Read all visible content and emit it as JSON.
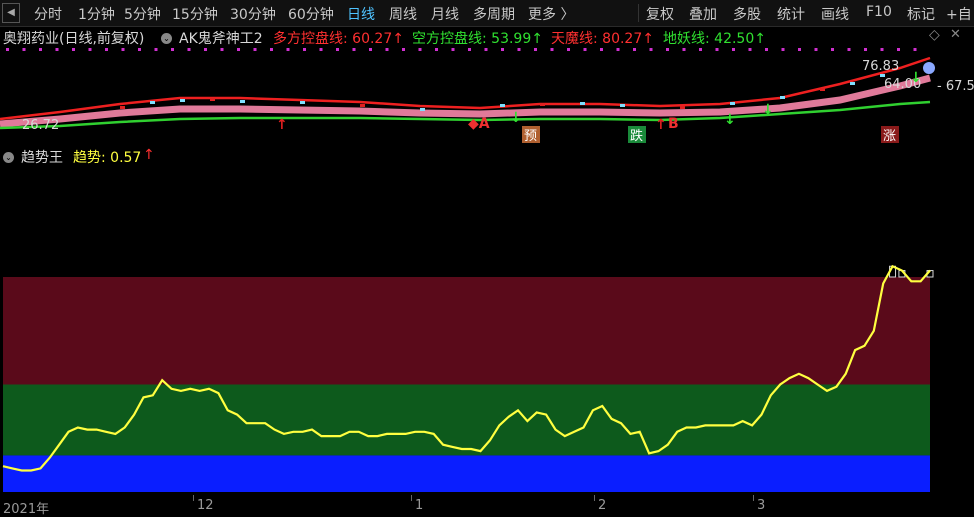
{
  "toolbar": {
    "tabs": [
      "分时",
      "1分钟",
      "5分钟",
      "15分钟",
      "30分钟",
      "60分钟",
      "日线",
      "周线",
      "月线",
      "多周期",
      "更多 〉"
    ],
    "active_tab": "日线",
    "right_buttons": [
      "复权",
      "叠加",
      "多股",
      "统计",
      "画线",
      "F10",
      "标记",
      "+自"
    ]
  },
  "main_header": {
    "stock": "奥翔药业(日线,前复权)",
    "indicator": "AK鬼斧神工2",
    "items": [
      {
        "label": "多方控盘线: 60.27↑",
        "color": "#ff3030"
      },
      {
        "label": "空方控盘线: 53.99↑",
        "color": "#30e030"
      },
      {
        "label": "天魔线: 80.27↑",
        "color": "#ff3030"
      },
      {
        "label": "地妖线: 42.50↑",
        "color": "#30e030"
      }
    ]
  },
  "price_labels": {
    "high": "76.83",
    "mid": "64.00",
    "right": "67.5",
    "low": "26.72"
  },
  "signals": [
    {
      "text": "预",
      "bg": "#b06030",
      "color": "#ffffff"
    },
    {
      "text": "跌",
      "bg": "#1a8a3a",
      "color": "#ffffff"
    },
    {
      "text": "涨",
      "bg": "#8a1a1a",
      "color": "#ffffff"
    }
  ],
  "markers": {
    "a": "A",
    "b": "B"
  },
  "sub_header": {
    "indicator": "趋势王",
    "value_label": "趋势: 0.57",
    "arrow": "↑",
    "value_color": "#ffff40"
  },
  "zones": {
    "top": "#5a0a1a",
    "middle": "#0d5a1c",
    "bottom": "#0a1eff"
  },
  "time_axis": [
    "2021年",
    "12",
    "1",
    "2",
    "3"
  ],
  "chart_data": {
    "type": "line",
    "series": [
      {
        "values": [
          0.12,
          0.11,
          0.1,
          0.1,
          0.11,
          0.16,
          0.22,
          0.28,
          0.3,
          0.29,
          0.29,
          0.28,
          0.27,
          0.3,
          0.36,
          0.44,
          0.45,
          0.52,
          0.48,
          0.47,
          0.48,
          0.47,
          0.48,
          0.46,
          0.38,
          0.36,
          0.32,
          0.32,
          0.32,
          0.29,
          0.27,
          0.28,
          0.28,
          0.29,
          0.26,
          0.26,
          0.26,
          0.28,
          0.28,
          0.26,
          0.26,
          0.27,
          0.27,
          0.27,
          0.28,
          0.28,
          0.27,
          0.22,
          0.21,
          0.2,
          0.2,
          0.19,
          0.24,
          0.31,
          0.35,
          0.38,
          0.33,
          0.37,
          0.36,
          0.29,
          0.26,
          0.28,
          0.3,
          0.38,
          0.4,
          0.34,
          0.32,
          0.27,
          0.28,
          0.18,
          0.19,
          0.22,
          0.28,
          0.3,
          0.3,
          0.31,
          0.31,
          0.31,
          0.31,
          0.33,
          0.31,
          0.36,
          0.45,
          0.5,
          0.53,
          0.55,
          0.53,
          0.5,
          0.47,
          0.49,
          0.55,
          0.66,
          0.68,
          0.75,
          0.97,
          1.05,
          1.03,
          0.98,
          0.98,
          1.03
        ],
        "color": "#ffff40"
      }
    ],
    "grid": false
  }
}
